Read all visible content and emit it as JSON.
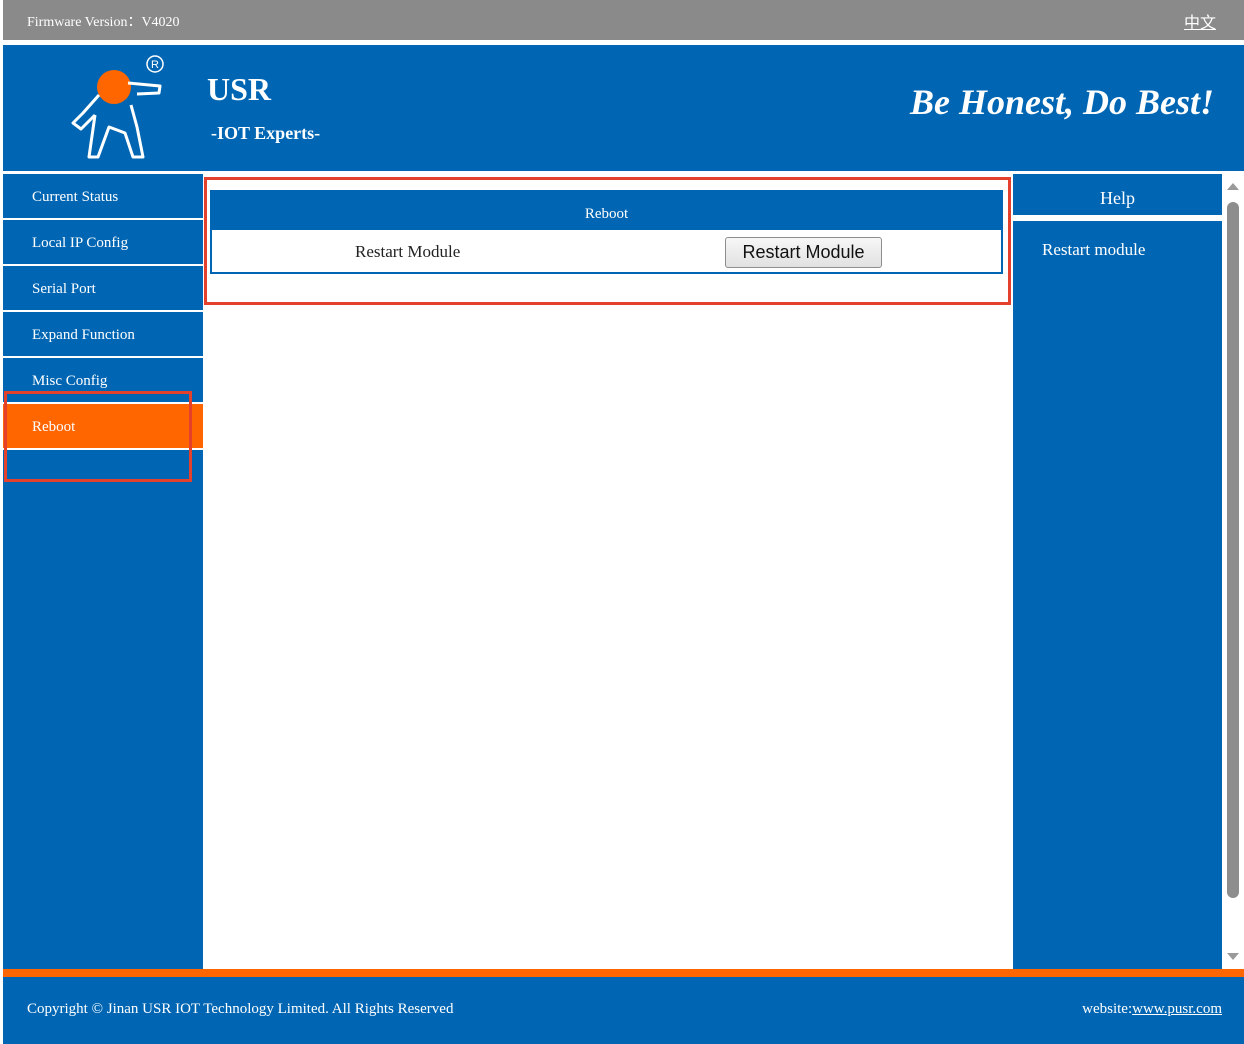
{
  "topbar": {
    "firmware_label": "Firmware Version：V4020",
    "language_link": "中文"
  },
  "header": {
    "brand_name": "USR",
    "brand_tagline": "-IOT Experts-",
    "slogan": "Be Honest, Do Best!",
    "logo_icon": "usr-running-man-logo",
    "registered_mark": "R"
  },
  "sidebar": {
    "items": [
      {
        "label": "Current Status"
      },
      {
        "label": "Local IP Config"
      },
      {
        "label": "Serial Port"
      },
      {
        "label": "Expand Function"
      },
      {
        "label": "Misc Config"
      },
      {
        "label": "Reboot",
        "active": true
      }
    ]
  },
  "main": {
    "panel_title": "Reboot",
    "restart_row_label": "Restart Module",
    "restart_button_label": "Restart Module"
  },
  "help": {
    "title": "Help",
    "text": "Restart module"
  },
  "footer": {
    "copyright": "Copyright © Jinan USR IOT Technology Limited. All Rights Reserved",
    "website_label": "website:",
    "website_link": "www.pusr.com"
  },
  "colors": {
    "primary_blue": "#0066b3",
    "accent_orange": "#ff6600",
    "topbar_gray": "#8a8a8a",
    "highlight_red": "#e3412b"
  }
}
